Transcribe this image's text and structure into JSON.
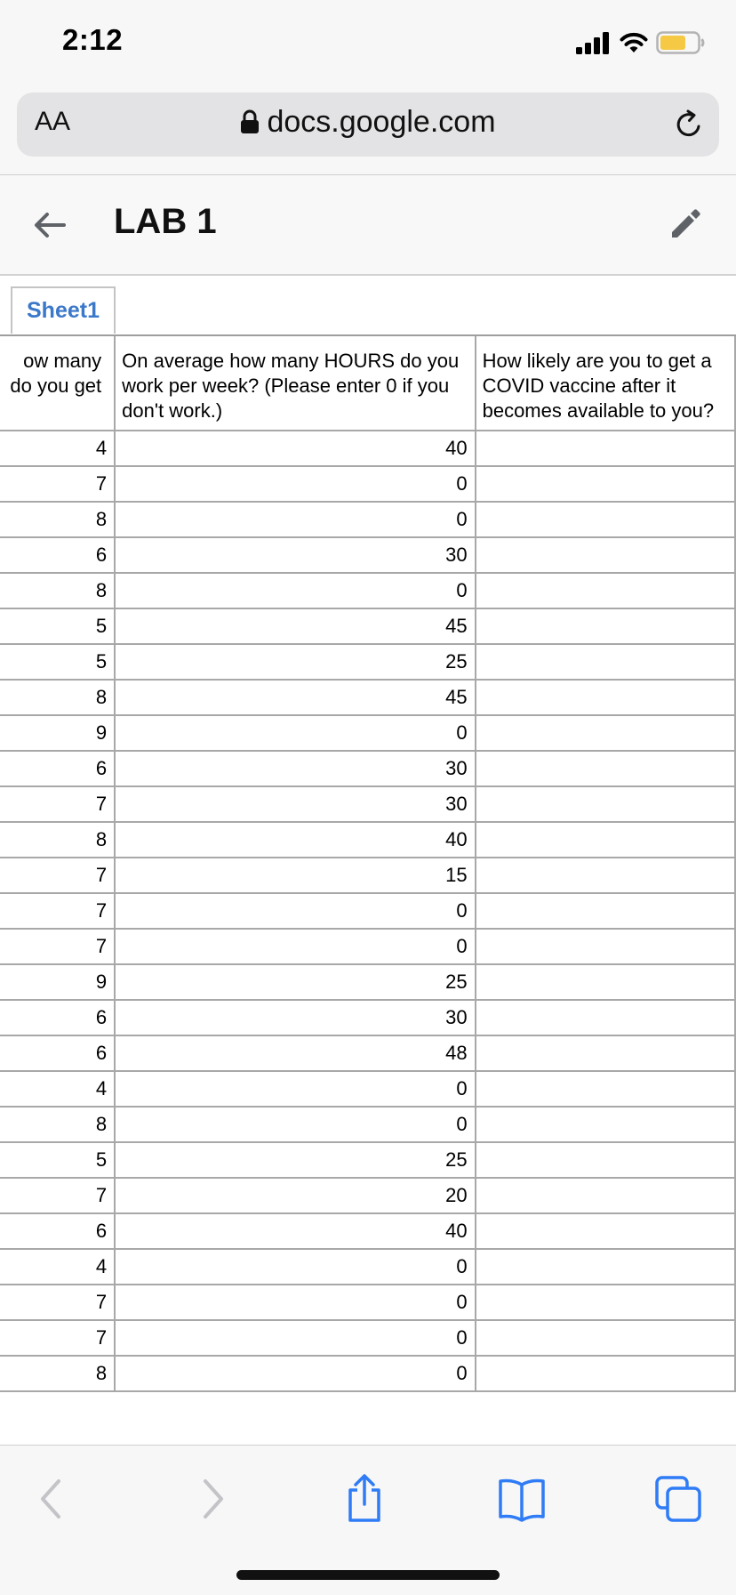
{
  "status_bar": {
    "time": "2:12"
  },
  "browser": {
    "text_size_label": "AA",
    "url": "docs.google.com"
  },
  "document": {
    "title": "LAB 1",
    "sheet_tab": "Sheet1"
  },
  "table": {
    "headers": [
      "ow many\n do you get",
      "On average how many HOURS do you work per week? (Please enter 0 if you don't work.)",
      "How likely are you to get a COVID vaccine after it becomes available to you?"
    ],
    "rows": [
      [
        "4",
        "40",
        ""
      ],
      [
        "7",
        "0",
        ""
      ],
      [
        "8",
        "0",
        ""
      ],
      [
        "6",
        "30",
        ""
      ],
      [
        "8",
        "0",
        ""
      ],
      [
        "5",
        "45",
        ""
      ],
      [
        "5",
        "25",
        ""
      ],
      [
        "8",
        "45",
        ""
      ],
      [
        "9",
        "0",
        ""
      ],
      [
        "6",
        "30",
        ""
      ],
      [
        "7",
        "30",
        ""
      ],
      [
        "8",
        "40",
        ""
      ],
      [
        "7",
        "15",
        ""
      ],
      [
        "7",
        "0",
        ""
      ],
      [
        "7",
        "0",
        ""
      ],
      [
        "9",
        "25",
        ""
      ],
      [
        "6",
        "30",
        ""
      ],
      [
        "6",
        "48",
        ""
      ],
      [
        "4",
        "0",
        ""
      ],
      [
        "8",
        "0",
        ""
      ],
      [
        "5",
        "25",
        ""
      ],
      [
        "7",
        "20",
        ""
      ],
      [
        "6",
        "40",
        ""
      ],
      [
        "4",
        "0",
        ""
      ],
      [
        "7",
        "0",
        ""
      ],
      [
        "7",
        "0",
        ""
      ],
      [
        "8",
        "0",
        ""
      ]
    ]
  },
  "icons": {
    "lock": "lock-icon",
    "reload": "reload-icon",
    "back": "arrow-left-icon",
    "edit": "pencil-icon",
    "share": "share-icon",
    "bookmarks": "book-icon",
    "tabs": "tabs-icon"
  },
  "colors": {
    "accent": "#3b78c9",
    "safari_blue": "#2f7cf6",
    "battery": "#f6c944"
  }
}
